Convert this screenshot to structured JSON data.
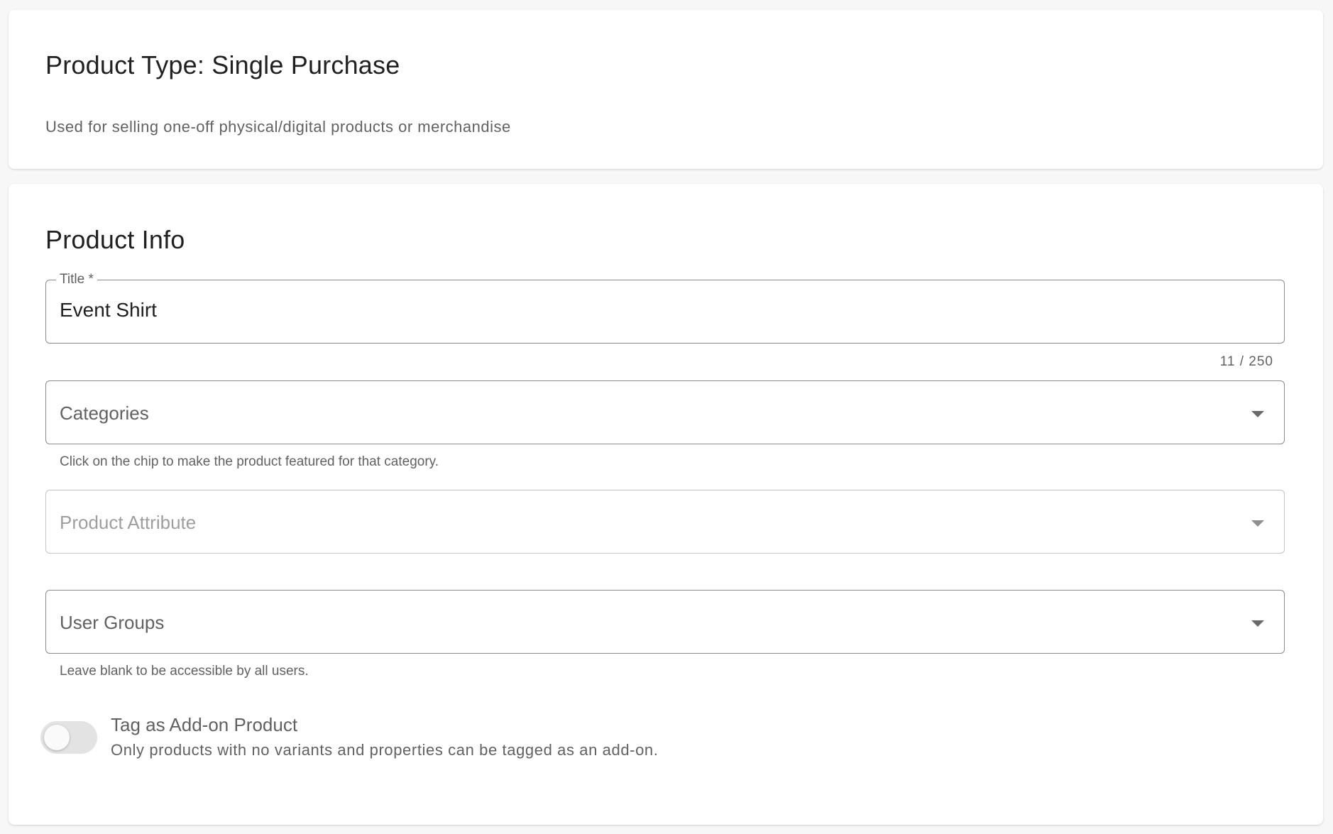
{
  "product_type_card": {
    "title": "Product Type: Single Purchase",
    "description": "Used for selling one-off physical/digital products or merchandise"
  },
  "product_info_card": {
    "title": "Product Info",
    "title_field": {
      "label": "Title *",
      "value": "Event Shirt",
      "counter": "11 / 250"
    },
    "categories_field": {
      "placeholder": "Categories",
      "hint": "Click on the chip to make the product featured for that category."
    },
    "product_attribute_field": {
      "placeholder": "Product Attribute"
    },
    "user_groups_field": {
      "placeholder": "User Groups",
      "hint": "Leave blank to be accessible by all users."
    },
    "addon_toggle": {
      "label": "Tag as Add-on Product",
      "description": "Only products with no variants and properties can be tagged as an add-on.",
      "checked": false
    }
  },
  "colors": {
    "page_background": "#f7f7f7",
    "card_background": "#ffffff",
    "field_border": "#8a8a8a",
    "disabled_field_border": "#c4c4c4",
    "toggle_track_off": "#e3e3e3"
  },
  "icons": {
    "dropdown": "caret-down-icon"
  }
}
